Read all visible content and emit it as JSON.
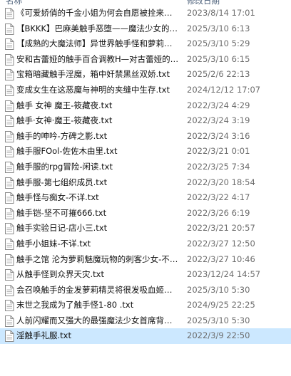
{
  "header": {
    "name_col": "名称",
    "date_col": "修改日期"
  },
  "files": [
    {
      "name": "《可爱娇俏的千金小姐为何会自愿被拴来当性奴》.txt",
      "date": "2023/8/14 17:01"
    },
    {
      "name": "【BKKK】巴麻美触手恶堕——魔法少女的悲惨结局.txt",
      "date": "2025/3/10 6:13"
    },
    {
      "name": "【成熟的大魔法师】异世界触手怪和萝莉魔法师.txt",
      "date": "2025/3/10 5:29"
    },
    {
      "name": "安和古蕾娅的触手百合调教H—对古蕾娅的触手调教.txt",
      "date": "2025/3/10 6:15"
    },
    {
      "name": "宝箱暗藏触手淫魔，箱中奸禁黑丝双娇.txt",
      "date": "2025/2/6 22:13"
    },
    {
      "name": "变成女生在这恶魔与神明的夹缝中生存.txt",
      "date": "2024/12/12 17:07"
    },
    {
      "name": "触手 女神 魔王-筱藏夜.txt",
      "date": "2022/3/24 4:29"
    },
    {
      "name": "触手·女神·魔王-筱藏夜.txt",
      "date": "2022/3/24 3:19"
    },
    {
      "name": "触手的呻吟-方碑之影.txt",
      "date": "2022/3/24 3:16"
    },
    {
      "name": "触手服FOol-佐佐木由里.txt",
      "date": "2022/3/21 0:01"
    },
    {
      "name": "触手服的rpg冒险-闲读.txt",
      "date": "2022/3/25 7:34"
    },
    {
      "name": "触手服-第七组织成员.txt",
      "date": "2022/3/20 18:54"
    },
    {
      "name": "触手怪与痴女-不详.txt",
      "date": "2022/3/22 4:17"
    },
    {
      "name": "触手铠-坚不可摧666.txt",
      "date": "2022/3/26 6:19"
    },
    {
      "name": "触手实验日记-店小三.txt",
      "date": "2022/3/21 20:57"
    },
    {
      "name": "触手小姐妹-不详.txt",
      "date": "2022/3/27 12:50"
    },
    {
      "name": "触手之馆 沦为萝莉魅魔玩物的刺客少女-不详.txt",
      "date": "2022/3/27 10:46"
    },
    {
      "name": "从触手怪到众界天灾.txt",
      "date": "2023/12/24 14:57"
    },
    {
      "name": "会召唤触手的金发萝莉精灵将很发吸血姬的灌溉.txt",
      "date": "2025/3/10 5:30"
    },
    {
      "name": "末世之我成为了触手怪1-80   .txt",
      "date": "2024/9/25 22:25"
    },
    {
      "name": "人前闪耀而又强大的最强魔法少女首席背地里的样子.txt",
      "date": "2025/3/10 5:30"
    },
    {
      "name": "淫触手礼服.txt",
      "date": "2022/3/9 22:50",
      "selected": true
    }
  ]
}
